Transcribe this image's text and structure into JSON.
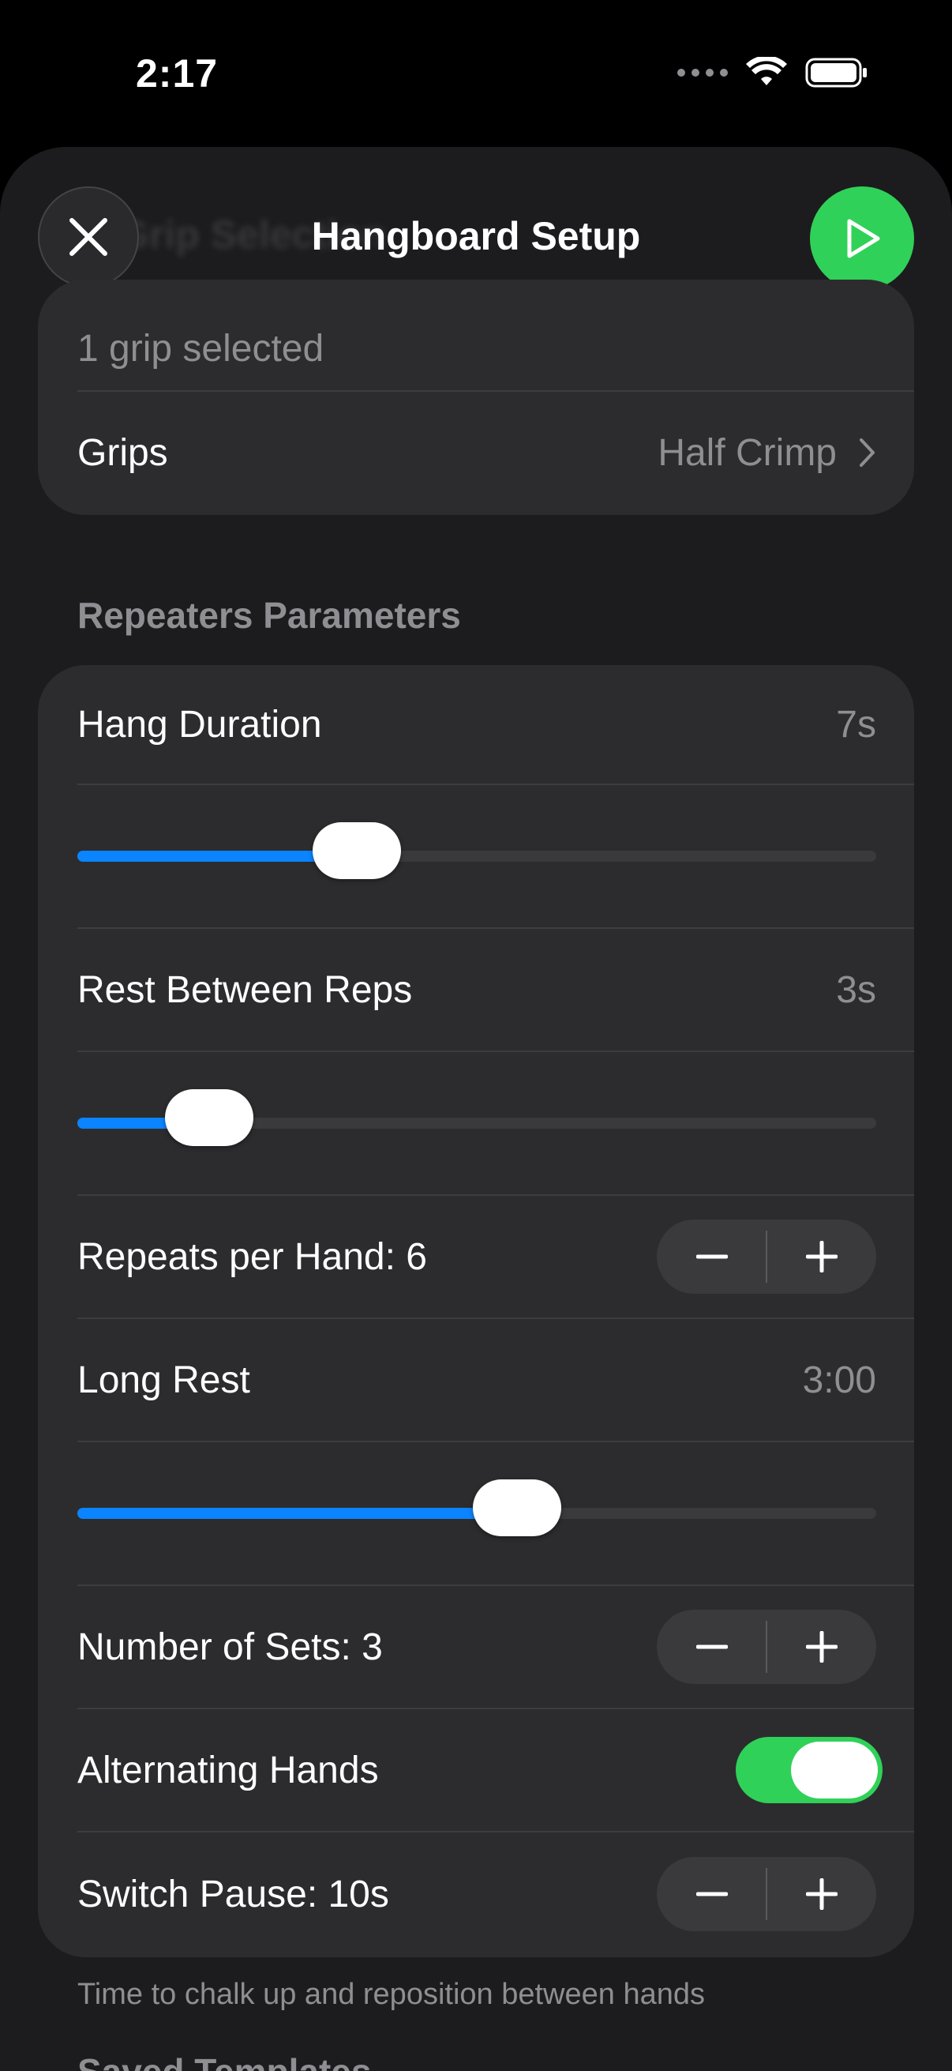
{
  "status_bar": {
    "time": "2:17"
  },
  "nav": {
    "title": "Hangboard Setup",
    "ghost_title": "Grip Selection"
  },
  "grips": {
    "summary": "1 grip selected",
    "label": "Grips",
    "value": "Half Crimp"
  },
  "section": {
    "title": "Repeaters Parameters"
  },
  "params": {
    "hang_duration": {
      "label": "Hang Duration",
      "value": "7s",
      "fraction": 0.35
    },
    "rest_between_reps": {
      "label": "Rest Between Reps",
      "value": "3s",
      "fraction": 0.165
    },
    "repeats_per_hand": {
      "label": "Repeats per Hand: 6"
    },
    "long_rest": {
      "label": "Long Rest",
      "value": "3:00",
      "fraction": 0.55
    },
    "number_of_sets": {
      "label": "Number of Sets: 3"
    },
    "alternating_hands": {
      "label": "Alternating Hands",
      "on": true
    },
    "switch_pause": {
      "label": "Switch Pause: 10s"
    }
  },
  "footer_note": "Time to chalk up and reposition between hands",
  "next_section": "Saved Templates",
  "colors": {
    "accent": "#0a84ff",
    "success": "#30d158",
    "background": "#1c1c1e",
    "card": "#2c2c2e"
  },
  "icons": {
    "close": "close-icon",
    "play": "play-icon",
    "chevron": "chevron-right-icon",
    "minus": "minus-icon",
    "plus": "plus-icon"
  }
}
